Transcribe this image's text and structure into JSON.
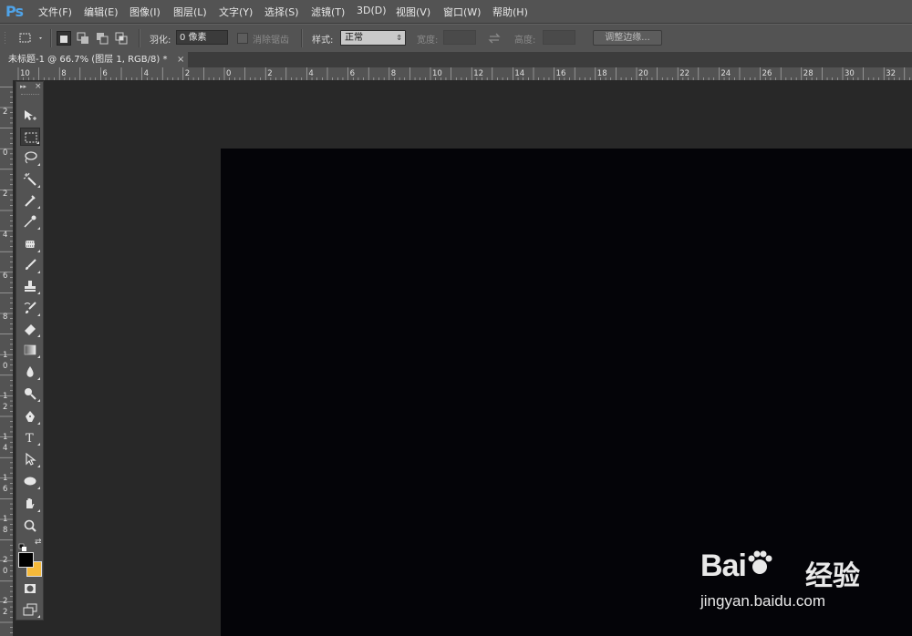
{
  "app": {
    "logo": "Ps"
  },
  "menu": [
    {
      "label": "文件(F)"
    },
    {
      "label": "编辑(E)"
    },
    {
      "label": "图像(I)"
    },
    {
      "label": "图层(L)"
    },
    {
      "label": "文字(Y)"
    },
    {
      "label": "选择(S)"
    },
    {
      "label": "滤镜(T)"
    },
    {
      "label": "3D(D)"
    },
    {
      "label": "视图(V)"
    },
    {
      "label": "窗口(W)"
    },
    {
      "label": "帮助(H)"
    }
  ],
  "options": {
    "feather_label": "羽化:",
    "feather_value": "0 像素",
    "antialias_label": "消除锯齿",
    "style_label": "样式:",
    "style_value": "正常",
    "width_label": "宽度:",
    "height_label": "高度:",
    "refine_edge_label": "调整边缘..."
  },
  "document_tab": {
    "title": "未标题-1 @ 66.7% (图层 1, RGB/8) *",
    "close": "×"
  },
  "ruler_h_labels": [
    "10",
    "8",
    "6",
    "4",
    "2",
    "0",
    "2",
    "4",
    "6",
    "8",
    "10",
    "12",
    "14",
    "16",
    "18",
    "20",
    "22",
    "24",
    "26",
    "28",
    "30",
    "32"
  ],
  "ruler_v_labels": [
    "2",
    "0",
    "2",
    "4",
    "6",
    "8",
    "1",
    "0",
    "1",
    "2",
    "1",
    "4",
    "1",
    "6",
    "1",
    "8",
    "2",
    "0",
    "2",
    "2"
  ],
  "toolbox": {
    "tools": [
      {
        "name": "move-tool",
        "icon": "move-icon"
      },
      {
        "name": "rectangular-marquee-tool",
        "icon": "marquee-icon",
        "active": true
      },
      {
        "name": "lasso-tool",
        "icon": "lasso-icon"
      },
      {
        "name": "magic-wand-tool",
        "icon": "magic-wand-icon"
      },
      {
        "name": "crop-tool",
        "icon": "crop-icon"
      },
      {
        "name": "eyedropper-tool",
        "icon": "eyedropper-icon"
      },
      {
        "name": "healing-brush-tool",
        "icon": "healing-brush-icon"
      },
      {
        "name": "brush-tool",
        "icon": "brush-icon"
      },
      {
        "name": "clone-stamp-tool",
        "icon": "clone-stamp-icon"
      },
      {
        "name": "history-brush-tool",
        "icon": "history-brush-icon"
      },
      {
        "name": "eraser-tool",
        "icon": "eraser-icon"
      },
      {
        "name": "gradient-tool",
        "icon": "gradient-icon"
      },
      {
        "name": "blur-tool",
        "icon": "blur-drop-icon"
      },
      {
        "name": "dodge-tool",
        "icon": "dodge-icon"
      },
      {
        "name": "pen-tool",
        "icon": "pen-icon"
      },
      {
        "name": "type-tool",
        "icon": "type-icon",
        "glyph": "T"
      },
      {
        "name": "path-selection-tool",
        "icon": "path-selection-icon"
      },
      {
        "name": "ellipse-tool",
        "icon": "ellipse-icon"
      },
      {
        "name": "hand-tool",
        "icon": "hand-icon"
      },
      {
        "name": "zoom-tool",
        "icon": "zoom-icon"
      }
    ],
    "foreground_color": "#000000",
    "background_color": "#f5b93a"
  },
  "canvas": {
    "document_color": "#040408"
  },
  "watermark": {
    "brand": "Bai",
    "brand2": "du",
    "suffix": "经验",
    "url": "jingyan.baidu.com"
  }
}
